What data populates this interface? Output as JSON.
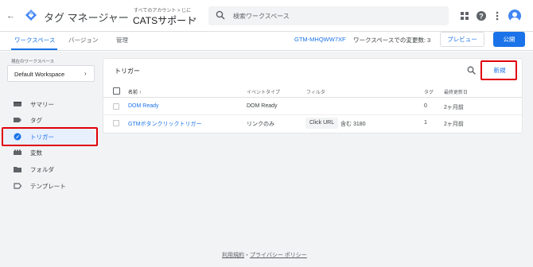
{
  "header": {
    "back_symbol": "←",
    "app_name": "タグ マネージャー",
    "account_path": "すべてのアカウント > じに",
    "container_name": "CATSサポート",
    "container_caret": "▾",
    "search_placeholder": "検索ワークスペース",
    "icons": [
      "apps-icon",
      "help-icon",
      "more-vert-icon",
      "avatar"
    ]
  },
  "subnav": {
    "tabs": [
      {
        "label": "ワークスペース",
        "active": true
      },
      {
        "label": "バージョン",
        "active": false
      },
      {
        "label": "管理",
        "active": false
      }
    ],
    "container_id": "GTM-MHQWW7XF",
    "changes_text": "ワークスペースでの変更数: 3",
    "preview_label": "プレビュー",
    "publish_label": "公開"
  },
  "sidebar": {
    "workspace_label": "現在のワークスペース",
    "workspace_name": "Default Workspace",
    "workspace_chevron": "›",
    "items": [
      {
        "label": "サマリー",
        "icon": "summary-icon",
        "active": false
      },
      {
        "label": "タグ",
        "icon": "tag-icon",
        "active": false
      },
      {
        "label": "トリガー",
        "icon": "trigger-icon",
        "active": true
      },
      {
        "label": "変数",
        "icon": "variable-icon",
        "active": false
      },
      {
        "label": "フォルダ",
        "icon": "folder-icon",
        "active": false
      },
      {
        "label": "テンプレート",
        "icon": "template-icon",
        "active": false
      }
    ]
  },
  "triggers": {
    "title": "トリガー",
    "new_label": "新規",
    "columns": {
      "name": "名前 ↑",
      "event_type": "イベントタイプ",
      "filter": "フィルタ",
      "tags": "タグ",
      "last_edited": "最終更新日"
    },
    "rows": [
      {
        "name": "DOM Ready",
        "event_type": "DOM Ready",
        "filter_chip": "",
        "filter_text": "",
        "tags": "0",
        "last_edited": "2ヶ月前"
      },
      {
        "name": "GTMボタンクリックトリガー",
        "event_type": "リンクのみ",
        "filter_chip": "Click URL",
        "filter_text": "含む 3180",
        "tags": "1",
        "last_edited": "2ヶ月前"
      }
    ]
  },
  "footer": {
    "terms": "利用規約",
    "separator": "・",
    "privacy": "プライバシー ポリシー"
  },
  "colors": {
    "accent": "#1a73e8",
    "highlight_box": "#e0000b",
    "background": "#f1f3f4"
  }
}
